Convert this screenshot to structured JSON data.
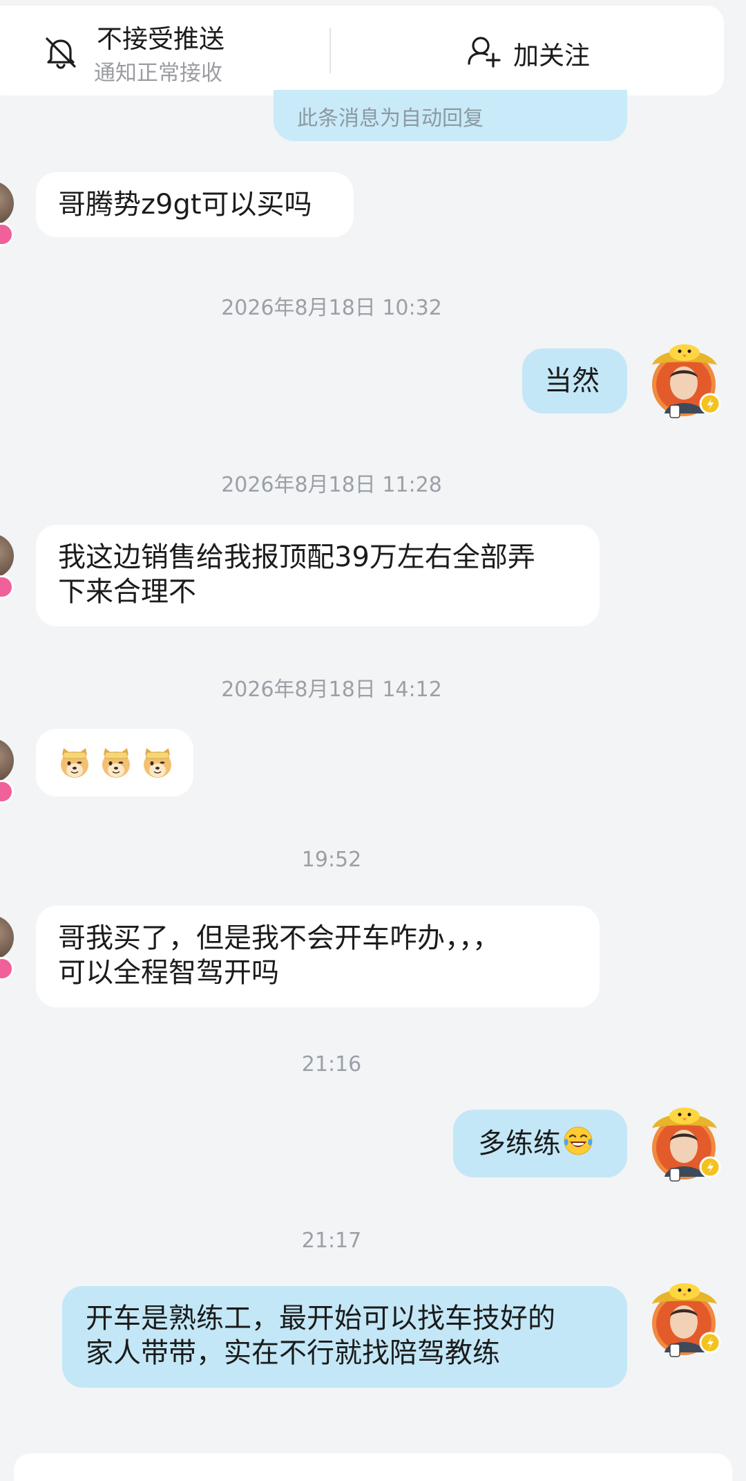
{
  "header": {
    "push_title": "不接受推送",
    "push_subtitle": "通知正常接收",
    "follow_label": "加关注"
  },
  "auto_reply_text": "此条消息为自动回复",
  "messages": [
    {
      "from": "other",
      "text": "哥腾势z9gt可以买吗"
    },
    {
      "timestamp": "2026年8月18日 10:32"
    },
    {
      "from": "me",
      "text": "当然"
    },
    {
      "timestamp": "2026年8月18日 11:28"
    },
    {
      "from": "other",
      "line1": "我这边销售给我报顶配39万左右全部弄",
      "line2": "下来合理不"
    },
    {
      "timestamp": "2026年8月18日 14:12"
    },
    {
      "from": "other",
      "emoji": [
        "doge-emoji",
        "doge-emoji",
        "doge-emoji"
      ]
    },
    {
      "timestamp": "19:52"
    },
    {
      "from": "other",
      "line1": "哥我买了，但是我不会开车咋办，，，",
      "line2": "可以全程智驾开吗"
    },
    {
      "timestamp": "21:16"
    },
    {
      "from": "me",
      "text": "多练练",
      "emoji": "laugh-cry-emoji"
    },
    {
      "timestamp": "21:17"
    },
    {
      "from": "me",
      "line1": "开车是熟练工，最开始可以找车技好的",
      "line2": "家人带带，实在不行就找陪驾教练"
    }
  ],
  "colors": {
    "background": "#f2f4f6",
    "incoming_bubble": "#ffffff",
    "outgoing_bubble": "#c3e7f6",
    "timestamp_text": "#9aa0a6",
    "badge_pink": "#f0609a",
    "badge_yellow": "#f4c21c"
  }
}
